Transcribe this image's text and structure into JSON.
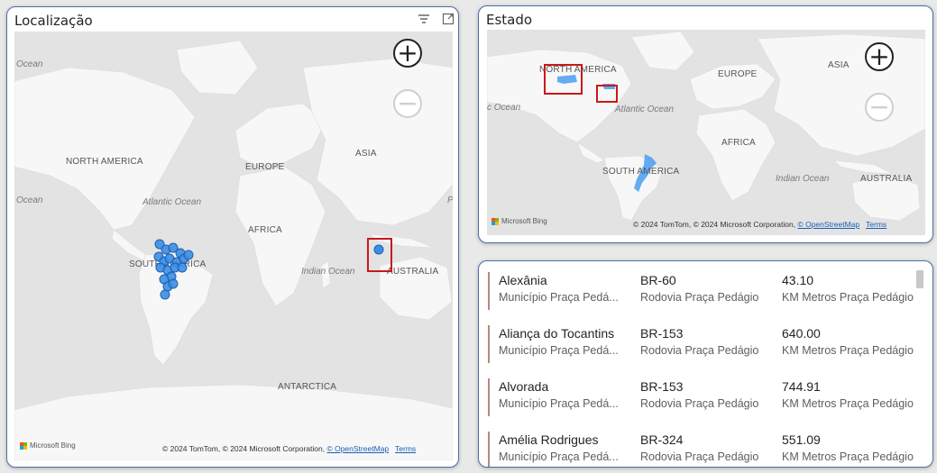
{
  "location_card": {
    "title": "Localização",
    "map": {
      "labels": {
        "north_america": "NORTH AMERICA",
        "europe": "EUROPE",
        "asia": "ASIA",
        "africa": "AFRICA",
        "south_america": "SOUTH AMERICA",
        "australia": "AUSTRALIA",
        "antarctica": "ANTARCTICA",
        "atlantic": "Atlantic Ocean",
        "indian": "Indian Ocean",
        "ocean_left_top": "Ocean",
        "ocean_left_mid": "Ocean",
        "ocean_right_mid": "P"
      },
      "bing": "Microsoft Bing",
      "attribution": "© 2024 TomTom, © 2024 Microsoft Corporation,",
      "osm": "© OpenStreetMap",
      "terms": "Terms",
      "zoom_in": "+",
      "zoom_out": "−"
    }
  },
  "state_card": {
    "title": "Estado",
    "map": {
      "labels": {
        "north_america": "NORTH AMERICA",
        "europe": "EUROPE",
        "asia": "ASIA",
        "africa": "AFRICA",
        "south_america": "SOUTH AMERICA",
        "australia": "AUSTRALIA",
        "atlantic": "Atlantic Ocean",
        "indian": "Indian Ocean",
        "ocean_left": "c Ocean"
      },
      "bing": "Microsoft Bing",
      "attribution": "© 2024 TomTom, © 2024 Microsoft Corporation,",
      "osm": "© OpenStreetMap",
      "terms": "Terms",
      "zoom_in": "+",
      "zoom_out": "−"
    }
  },
  "table": {
    "rows": [
      {
        "col1": "Alexânia",
        "col1_sub": "Município Praça Pedá...",
        "col2": "BR-60",
        "col2_sub": "Rodovia Praça Pedágio",
        "col3": "43.10",
        "col3_sub": "KM Metros Praça Pedágio"
      },
      {
        "col1": "Aliança do Tocantins",
        "col1_sub": "Município Praça Pedá...",
        "col2": "BR-153",
        "col2_sub": "Rodovia Praça Pedágio",
        "col3": "640.00",
        "col3_sub": "KM Metros Praça Pedágio"
      },
      {
        "col1": "Alvorada",
        "col1_sub": "Município Praça Pedá...",
        "col2": "BR-153",
        "col2_sub": "Rodovia Praça Pedágio",
        "col3": "744.91",
        "col3_sub": "KM Metros Praça Pedágio"
      },
      {
        "col1": "Amélia Rodrigues",
        "col1_sub": "Município Praça Pedá...",
        "col2": "BR-324",
        "col2_sub": "Rodovia Praça Pedágio",
        "col3": "551.09",
        "col3_sub": "KM Metros Praça Pedágio"
      }
    ]
  },
  "colors": {
    "accent": "#4a6fa5",
    "marker": "#3a8ee6",
    "highlight": "#c8191a",
    "land": "#f7f7f7",
    "water": "#e3e3e3"
  }
}
